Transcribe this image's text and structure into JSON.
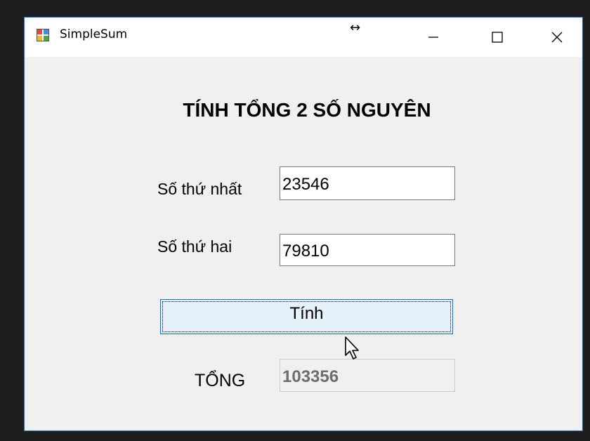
{
  "window": {
    "title": "SimpleSum",
    "resize_glyph": "↔",
    "controls": {
      "minimize_icon": "minimize-icon",
      "maximize_icon": "maximize-icon",
      "close_icon": "close-icon"
    },
    "accent_color": "#0078d7"
  },
  "form": {
    "heading": "TÍNH TỔNG 2 SỐ NGUYÊN",
    "first_number": {
      "label": "Số thứ nhất",
      "value": "23546"
    },
    "second_number": {
      "label": "Số thứ hai",
      "value": "79810"
    },
    "compute_button": {
      "label": "Tính"
    },
    "total": {
      "label": "TỔNG",
      "value": "103356"
    }
  }
}
